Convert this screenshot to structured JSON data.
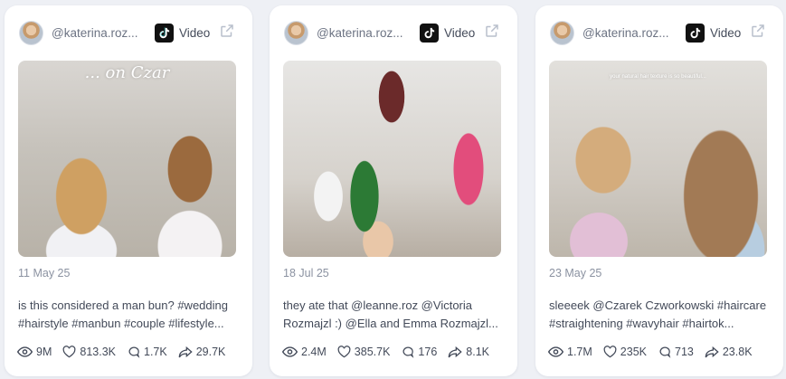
{
  "cards": [
    {
      "handle": "@katerina.roz...",
      "type_label": "Video",
      "overlay_text": "... on Czar",
      "date": "11 May 25",
      "caption": "is this considered a man bun? #wedding #hairstyle #manbun #couple #lifestyle...",
      "views": "9M",
      "likes": "813.3K",
      "comments": "1.7K",
      "shares": "29.7K"
    },
    {
      "handle": "@katerina.roz...",
      "type_label": "Video",
      "overlay_text": "",
      "date": "18 Jul 25",
      "caption": "they ate that @leanne.roz @Victoria Rozmajzl :) @Ella and Emma Rozmajzl...",
      "views": "2.4M",
      "likes": "385.7K",
      "comments": "176",
      "shares": "8.1K"
    },
    {
      "handle": "@katerina.roz...",
      "type_label": "Video",
      "overlay_text": "your natural hair texture is so beautiful...",
      "date": "23 May 25",
      "caption": "sleeeek @Czarek Czworkowski #haircare #straightening #wavyhair #hairtok...",
      "views": "1.7M",
      "likes": "235K",
      "comments": "713",
      "shares": "23.8K"
    }
  ],
  "icons": {
    "platform": "tiktok-logo-icon",
    "external": "external-link-icon",
    "views": "eye-icon",
    "likes": "heart-icon",
    "comments": "comment-icon",
    "shares": "share-icon"
  },
  "colors": {
    "background": "#eef0f5",
    "card": "#ffffff",
    "muted_text": "#8b92a1",
    "body_text": "#434a59"
  }
}
